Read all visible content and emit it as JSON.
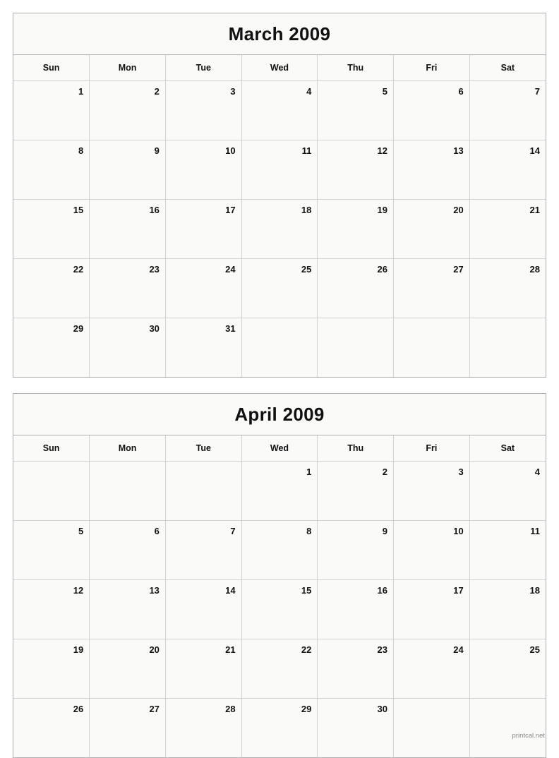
{
  "page": {
    "footer": "printcal.net"
  },
  "calendars": [
    {
      "title": "March 2009",
      "weekday_headers": [
        "Sun",
        "Mon",
        "Tue",
        "Wed",
        "Thu",
        "Fri",
        "Sat"
      ],
      "weeks": [
        [
          "1",
          "2",
          "3",
          "4",
          "5",
          "6",
          "7"
        ],
        [
          "8",
          "9",
          "10",
          "11",
          "12",
          "13",
          "14"
        ],
        [
          "15",
          "16",
          "17",
          "18",
          "19",
          "20",
          "21"
        ],
        [
          "22",
          "23",
          "24",
          "25",
          "26",
          "27",
          "28"
        ],
        [
          "29",
          "30",
          "31",
          "",
          "",
          "",
          ""
        ]
      ]
    },
    {
      "title": "April 2009",
      "weekday_headers": [
        "Sun",
        "Mon",
        "Tue",
        "Wed",
        "Thu",
        "Fri",
        "Sat"
      ],
      "weeks": [
        [
          "",
          "",
          "",
          "1",
          "2",
          "3",
          "4"
        ],
        [
          "5",
          "6",
          "7",
          "8",
          "9",
          "10",
          "11"
        ],
        [
          "12",
          "13",
          "14",
          "15",
          "16",
          "17",
          "18"
        ],
        [
          "19",
          "20",
          "21",
          "22",
          "23",
          "24",
          "25"
        ],
        [
          "26",
          "27",
          "28",
          "29",
          "30",
          "",
          ""
        ]
      ]
    }
  ]
}
